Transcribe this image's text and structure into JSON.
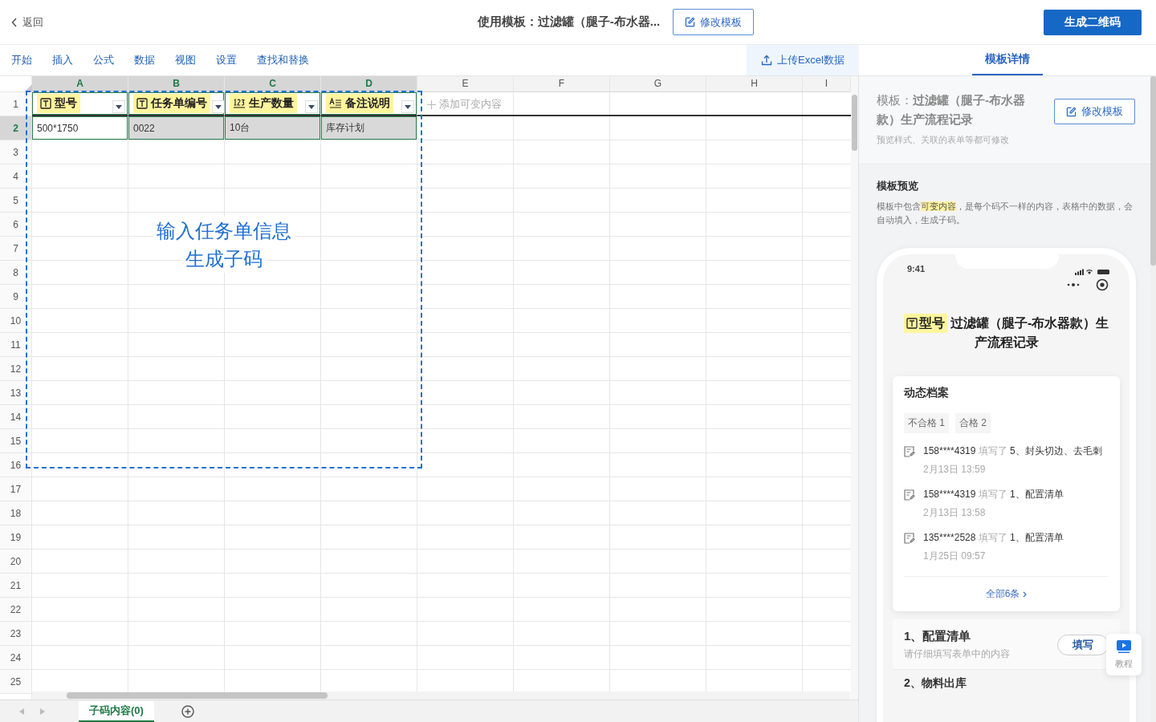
{
  "top_bar": {
    "back": "返回",
    "title": "使用模板：过滤罐（腿子-布水器...",
    "edit_button": "修改模板",
    "generate_button": "生成二维码"
  },
  "menu": [
    "开始",
    "插入",
    "公式",
    "数据",
    "视图",
    "设置",
    "查找和替换"
  ],
  "upload_button": "上传Excel数据",
  "panel_tabs": [
    {
      "label": "模板详情",
      "selected": true
    }
  ],
  "sheet": {
    "columns": [
      {
        "label": "A",
        "selected": true
      },
      {
        "label": "B",
        "selected": true
      },
      {
        "label": "C",
        "selected": true
      },
      {
        "label": "D",
        "selected": true
      },
      {
        "label": "E",
        "selected": false
      },
      {
        "label": "F",
        "selected": false
      },
      {
        "label": "G",
        "selected": false
      },
      {
        "label": "H",
        "selected": false
      },
      {
        "label": "I",
        "selected": false
      }
    ],
    "row_numbers": [
      {
        "label": "1",
        "selected": false
      },
      {
        "label": "2",
        "selected": true
      },
      {
        "label": "3",
        "selected": false
      },
      {
        "label": "4",
        "selected": false
      },
      {
        "label": "5",
        "selected": false
      },
      {
        "label": "6",
        "selected": false
      },
      {
        "label": "7",
        "selected": false
      },
      {
        "label": "8",
        "selected": false
      },
      {
        "label": "9",
        "selected": false
      },
      {
        "label": "10",
        "selected": false
      },
      {
        "label": "11",
        "selected": false
      },
      {
        "label": "12",
        "selected": false
      },
      {
        "label": "13",
        "selected": false
      },
      {
        "label": "14",
        "selected": false
      },
      {
        "label": "15",
        "selected": false
      },
      {
        "label": "16",
        "selected": false
      },
      {
        "label": "17",
        "selected": false
      },
      {
        "label": "18",
        "selected": false
      },
      {
        "label": "19",
        "selected": false
      },
      {
        "label": "20",
        "selected": false
      },
      {
        "label": "21",
        "selected": false
      },
      {
        "label": "22",
        "selected": false
      },
      {
        "label": "23",
        "selected": false
      },
      {
        "label": "24",
        "selected": false
      },
      {
        "label": "25",
        "selected": false
      }
    ],
    "header_cells": [
      {
        "kind": "text",
        "label": "型号"
      },
      {
        "kind": "text",
        "label": "任务单编号"
      },
      {
        "kind": "number",
        "label": "生产数量"
      },
      {
        "kind": "note",
        "label": "备注说明"
      }
    ],
    "add_variable": "添加可变内容",
    "data_row": [
      {
        "value": "500*1750",
        "shaded": false
      },
      {
        "value": "0022",
        "shaded": true
      },
      {
        "value": "10台",
        "shaded": true
      },
      {
        "value": "库存计划",
        "shaded": true
      }
    ],
    "annotation": [
      "输入任务单信息",
      "生成子码"
    ],
    "sheet_tabs": [
      {
        "label": "子码内容(0)",
        "selected": true
      }
    ]
  },
  "panel": {
    "template_title": "模板：**过滤罐（腿子-布水器款）生产流程记录**",
    "edit_button": "修改模板",
    "note": "预览样式、关联的表单等都可修改",
    "preview_heading": "模板预览",
    "preview_description": [
      {
        "text": "模板中包含",
        "highlight": false
      },
      {
        "text": "可变内容",
        "highlight": true
      },
      {
        "text": "，是每个码不一样的内容，表格中的数据，会自动填入，生成子码。",
        "highlight": false
      }
    ],
    "phone": {
      "time": "9:41",
      "variable_label": "型号",
      "title": "过滤罐（腿子-布水器款）生产流程记录",
      "activity": {
        "heading": "动态档案",
        "tags": [
          "不合格 1",
          "合格 2"
        ],
        "entries": [
          {
            "user": "158****4319",
            "action": "填写了",
            "item": "5、封头切边、去毛刺",
            "time": "2月13日 13:59"
          },
          {
            "user": "158****4319",
            "action": "填写了",
            "item": "1、配置清单",
            "time": "2月13日 13:58"
          },
          {
            "user": "135****2528",
            "action": "填写了",
            "item": "1、配置清单",
            "time": "1月25日 09:57"
          }
        ],
        "more_link": "全部6条"
      },
      "forms": [
        {
          "title": "1、配置清单",
          "hint": "请仔细填写表单中的内容",
          "button": "填写"
        },
        {
          "title": "2、物料出库"
        }
      ]
    },
    "help_button": "教程"
  }
}
